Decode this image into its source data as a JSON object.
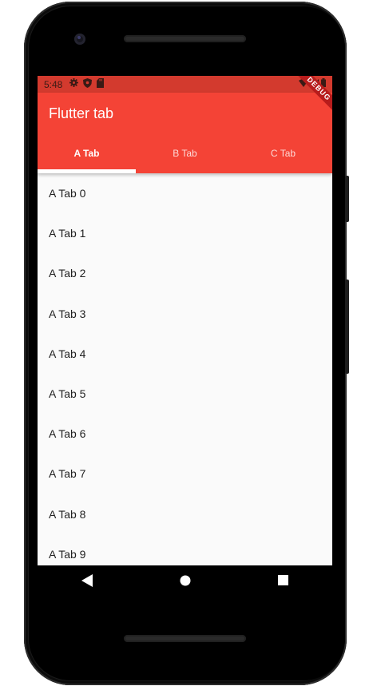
{
  "status_bar": {
    "time": "5:48"
  },
  "app_bar": {
    "title": "Flutter tab"
  },
  "debug_banner": "DEBUG",
  "tabs": [
    {
      "label": "A Tab",
      "active": true
    },
    {
      "label": "B Tab",
      "active": false
    },
    {
      "label": "C Tab",
      "active": false
    }
  ],
  "list_items": [
    "A Tab 0",
    "A Tab 1",
    "A Tab 2",
    "A Tab 3",
    "A Tab 4",
    "A Tab 5",
    "A Tab 6",
    "A Tab 7",
    "A Tab 8",
    "A Tab 9"
  ],
  "colors": {
    "primary": "#f44336",
    "status_bar": "#d33a2e",
    "background": "#fafafa"
  },
  "nav_icons": [
    "back-icon",
    "home-icon",
    "recents-icon"
  ]
}
